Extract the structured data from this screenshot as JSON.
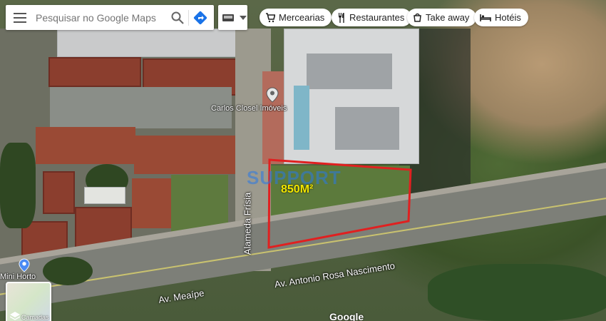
{
  "search": {
    "placeholder": "Pesquisar no Google Maps"
  },
  "chips": [
    {
      "label": "Mercearias",
      "icon": "cart-icon"
    },
    {
      "label": "Restaurantes",
      "icon": "fork-knife-icon"
    },
    {
      "label": "Take away",
      "icon": "takeaway-icon"
    },
    {
      "label": "Hotéis",
      "icon": "bed-icon"
    }
  ],
  "places": {
    "carlos_closel": "Carlos Closel Imóveis",
    "mini_horto": "Mini Horto"
  },
  "streets": {
    "alameda_frisia": "Alameda Frísia",
    "av_meaipe": "Av. Meaípe",
    "av_antonio": "Av. Antonio Rosa Nascimento"
  },
  "overlay": {
    "watermark": "SUPPORT",
    "area": "850M²"
  },
  "layers": {
    "label": "Camadas"
  },
  "logo": "Google",
  "colors": {
    "highlight": "#e02020",
    "area_text": "#f2e600",
    "pin_blue": "#4a8af4"
  }
}
